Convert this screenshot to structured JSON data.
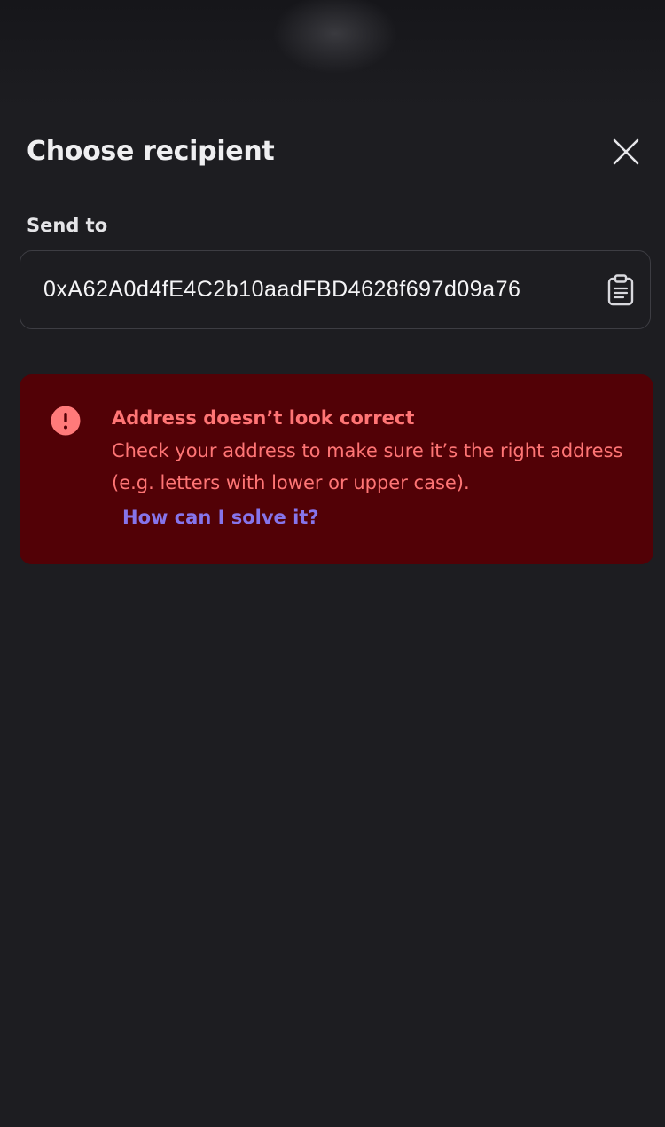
{
  "header": {
    "title": "Choose recipient",
    "close_icon": "close-icon"
  },
  "recipient": {
    "label": "Send to",
    "address": "0xA62A0d4fE4C2b10aadFBD4628f697d09a76",
    "paste_icon": "clipboard-icon"
  },
  "error": {
    "icon": "exclamation-circle-icon",
    "title": "Address doesn’t look correct",
    "message": "Check your address to make sure it’s the right address (e.g. letters with lower or upper case).",
    "help_link": "How can I solve it?"
  },
  "colors": {
    "background": "#1d1d21",
    "error_background": "#520106",
    "error_text": "#ff7575",
    "link": "#8674ea",
    "field_border": "#3d3d43"
  }
}
